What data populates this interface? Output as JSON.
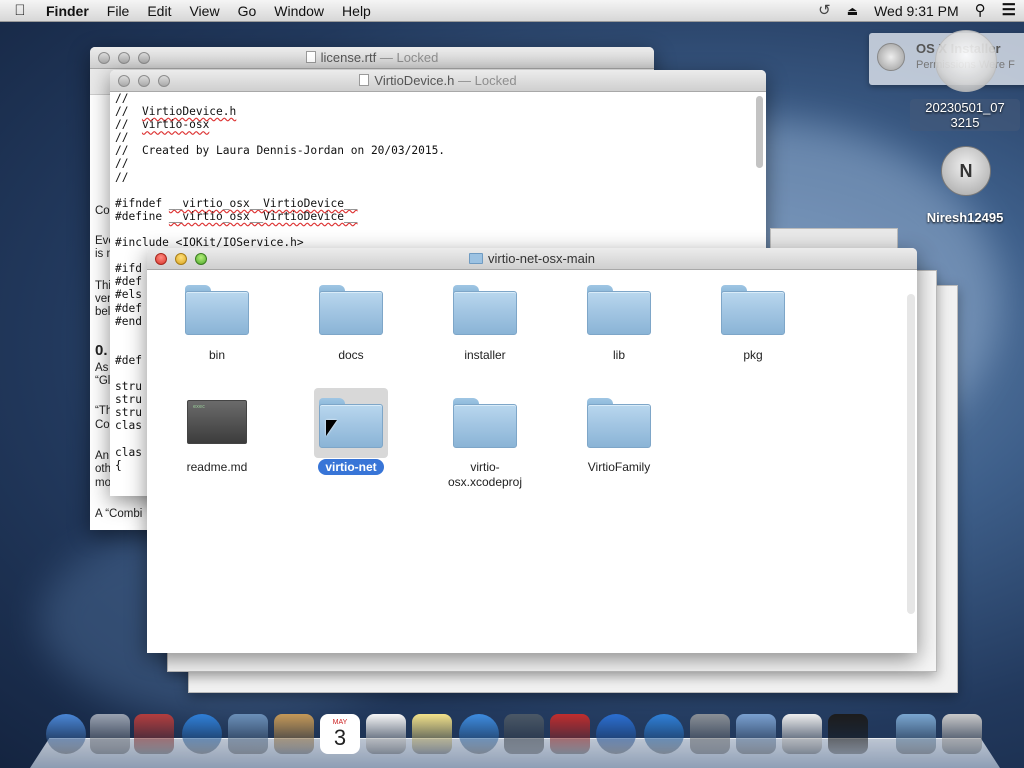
{
  "menubar": {
    "app": "Finder",
    "items": [
      "File",
      "Edit",
      "View",
      "Go",
      "Window",
      "Help"
    ],
    "clock": "Wed 9:31 PM"
  },
  "notification": {
    "title": "OS X Installer",
    "text": "Permissions Were F"
  },
  "desktop": {
    "disk_label_line1": "20230501_07",
    "disk_label_line2": "3215",
    "user_label": "Niresh12495",
    "user_initial": "N"
  },
  "license_window": {
    "title": "license.rtf",
    "locked": "— Locked",
    "fragments": [
      "Co",
      "Eve",
      "is n",
      "Thi",
      "ver",
      "bel",
      "0.",
      "As",
      "“Gl",
      "“Th",
      "Co",
      "An",
      "oth",
      "mo",
      "A “Combi"
    ]
  },
  "header_window": {
    "title": "VirtioDevice.h",
    "locked": "— Locked",
    "code": [
      "//",
      "//  VirtioDevice.h",
      "//  virtio-osx",
      "//",
      "//  Created by Laura Dennis-Jordan on 20/03/2015.",
      "//",
      "//",
      "",
      "#ifndef __virtio_osx__VirtioDevice__",
      "#define __virtio_osx__VirtioDevice__",
      "",
      "#include <IOKit/IOService.h>",
      "",
      "#ifd",
      "#def",
      "#els",
      "#def",
      "#end",
      "",
      "",
      "#def",
      "",
      "stru",
      "stru",
      "stru",
      "clas",
      "",
      "clas",
      "{"
    ]
  },
  "finder_window": {
    "title": "virtio-net-osx-main",
    "items": [
      {
        "label": "bin",
        "kind": "folder"
      },
      {
        "label": "docs",
        "kind": "folder"
      },
      {
        "label": "installer",
        "kind": "folder"
      },
      {
        "label": "lib",
        "kind": "folder"
      },
      {
        "label": "pkg",
        "kind": "folder"
      },
      {
        "label": "readme.md",
        "kind": "file",
        "file_tag": "exec"
      },
      {
        "label": "virtio-net",
        "kind": "folder",
        "selected": true
      },
      {
        "label": "virtio-\nosx.xcodeproj",
        "kind": "folder"
      },
      {
        "label": "VirtioFamily",
        "kind": "folder"
      }
    ]
  },
  "dock": {
    "apps": [
      "Finder",
      "Launchpad",
      "Photo Booth",
      "Safari",
      "Mail",
      "Contacts",
      "Calendar",
      "Reminders",
      "Notes",
      "Messages",
      "FaceTime",
      "Photo Booth",
      "iTunes",
      "App Store",
      "System Preferences",
      "Xcode",
      "TextEdit",
      "Terminal",
      "Documents",
      "Trash"
    ],
    "calendar_day": "3",
    "calendar_month": "MAY"
  },
  "colors": {
    "selection": "#3875d7",
    "folder": "#a3c6e3"
  }
}
